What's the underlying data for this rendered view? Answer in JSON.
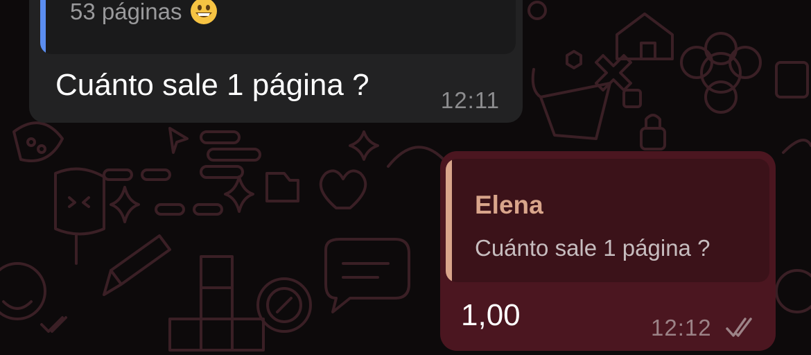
{
  "chat": {
    "incoming": {
      "quote_text": "53 páginas",
      "quote_emoji": "grinning-face-icon",
      "text": "Cuánto sale 1 página ?",
      "time": "12:11"
    },
    "outgoing": {
      "quote_sender": "Elena",
      "quote_text": "Cuánto sale 1 página ?",
      "text": "1,00",
      "time": "12:12",
      "status_icon": "double-check-icon"
    }
  },
  "colors": {
    "background": "#0d0a0b",
    "incoming_bubble": "#222223",
    "incoming_quote_bar": "#5b8def",
    "outgoing_bubble": "#4b1620",
    "outgoing_quote_bar": "#d9a58b",
    "outgoing_quote_name": "#d9a58b"
  }
}
